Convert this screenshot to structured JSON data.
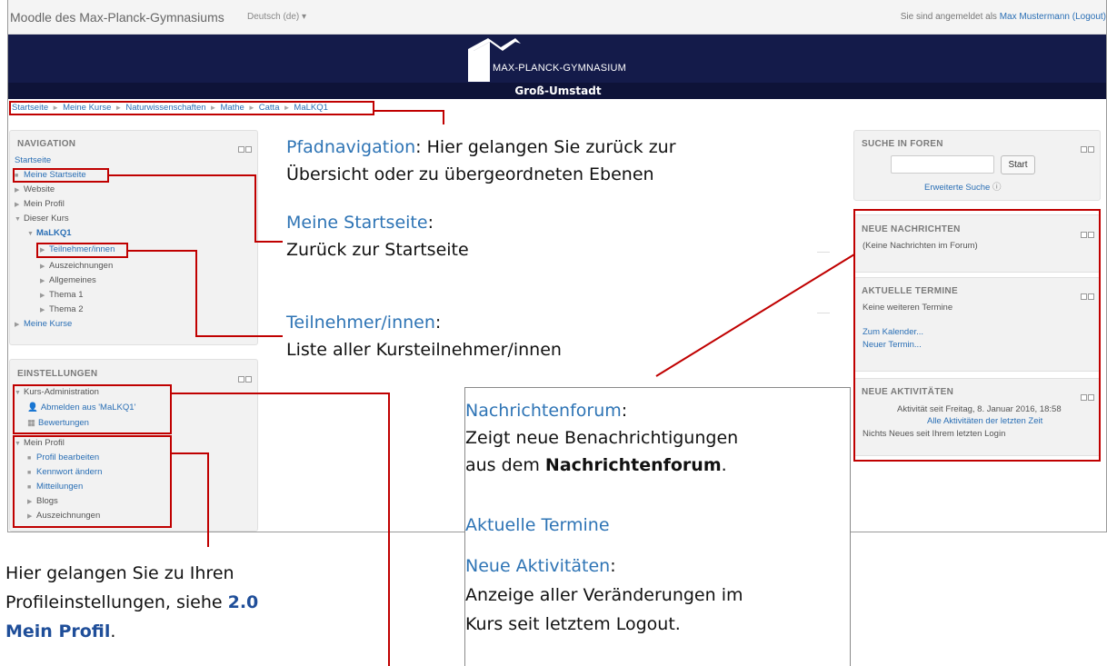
{
  "navbar": {
    "brand": "Moodle des Max-Planck-Gymnasiums",
    "language": "Deutsch (de) ▾",
    "login_prefix": "Sie sind angemeldet als ",
    "login_user": "Max Mustermann",
    "logout": "(Logout)"
  },
  "banner": {
    "school": "MAX-PLANCK-GYMNASIUM",
    "town": "Groß-Umstadt"
  },
  "breadcrumb": [
    "Startseite",
    "Meine Kurse",
    "Naturwissenschaften",
    "Mathe",
    "Catta",
    "MaLKQ1"
  ],
  "navigation": {
    "title": "NAVIGATION",
    "home": "Startseite",
    "items": {
      "my_home": "Meine Startseite",
      "website": "Website",
      "my_profile": "Mein Profil",
      "this_course": "Dieser Kurs",
      "course": "MaLKQ1",
      "participants": "Teilnehmer/innen",
      "badges": "Auszeichnungen",
      "general": "Allgemeines",
      "topic1": "Thema 1",
      "topic2": "Thema 2",
      "my_courses": "Meine Kurse"
    }
  },
  "settings": {
    "title": "EINSTELLUNGEN",
    "course_admin": "Kurs-Administration",
    "unenrol": "Abmelden aus 'MaLKQ1'",
    "grades": "Bewertungen",
    "my_profile": "Mein Profil",
    "edit_profile": "Profil bearbeiten",
    "change_password": "Kennwort ändern",
    "messages": "Mitteilungen",
    "blogs": "Blogs",
    "badges": "Auszeichnungen"
  },
  "search_forums": {
    "title": "SUCHE IN FOREN",
    "button": "Start",
    "advanced": "Erweiterte Suche"
  },
  "news": {
    "title": "NEUE NACHRICHTEN",
    "empty": "(Keine Nachrichten im Forum)"
  },
  "events": {
    "title": "AKTUELLE TERMINE",
    "empty": "Keine weiteren Termine",
    "calendar": "Zum Kalender...",
    "new_event": "Neuer Termin..."
  },
  "activity": {
    "title": "NEUE AKTIVITÄTEN",
    "since": "Aktivität seit Freitag, 8. Januar 2016, 18:58",
    "all": "Alle Aktivitäten der letzten Zeit",
    "nothing": "Nichts Neues seit Ihrem letzten Login"
  },
  "annotations": {
    "breadcrumb_title": "Pfadnavigation",
    "breadcrumb_text1": ": Hier gelangen Sie zurück zur",
    "breadcrumb_text2": "Übersicht oder zu übergeordneten Ebenen",
    "home_title": "Meine Startseite",
    "home_colon": ":",
    "home_text": "Zurück zur Startseite",
    "participants_title": "Teilnehmer/innen",
    "participants_colon": ":",
    "participants_text": "Liste aller Kursteilnehmer/innen",
    "profile_text1": "Hier gelangen Sie zu Ihren",
    "profile_text2": "Profileinstellungen, siehe ",
    "profile_ref1": "2.0",
    "profile_ref2": "Mein Profil",
    "profile_dot": ".",
    "forum_title": "Nachrichtenforum",
    "forum_colon": ":",
    "forum_text1": "Zeigt neue Benachrichtigungen",
    "forum_text2": "aus dem ",
    "forum_bold": "Nachrichtenforum",
    "forum_dot": ".",
    "events_title": "Aktuelle Termine",
    "activity_title": "Neue Aktivitäten",
    "activity_colon": ":",
    "activity_text1": "Anzeige aller Veränderungen im",
    "activity_text2": "Kurs seit letztem Logout."
  },
  "colors": {
    "header_bg": "#141b4a",
    "annotation_red": "#c00000",
    "annotation_blue": "#2e74b5",
    "link_blue": "#2a6fb5"
  }
}
